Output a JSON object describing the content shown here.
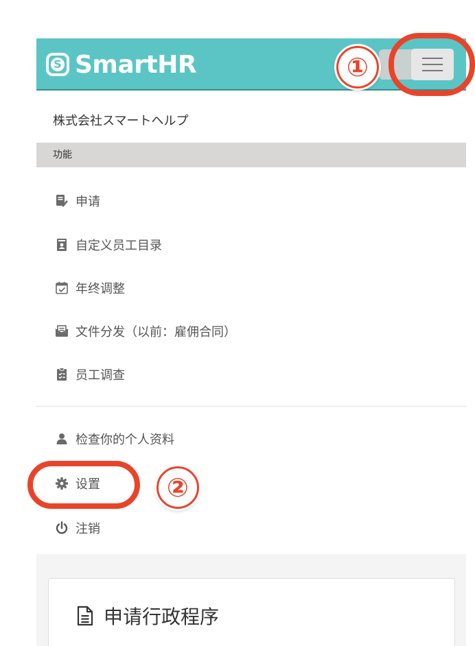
{
  "header": {
    "brand": "SmartHR",
    "brand_color": "#5bc5c6"
  },
  "annotations": {
    "badge_1": "①",
    "badge_2": "②",
    "color": "#e9442a"
  },
  "company_name": "株式会社スマートヘルプ",
  "section_label": "功能",
  "menu": {
    "features": [
      {
        "label": "申请",
        "icon": "request-check-icon"
      },
      {
        "label": "自定义员工目录",
        "icon": "address-book-icon"
      },
      {
        "label": "年终调整",
        "icon": "calendar-check-icon"
      },
      {
        "label": "文件分发（以前：雇佣合同）",
        "icon": "document-delivery-icon"
      },
      {
        "label": "员工调查",
        "icon": "clipboard-survey-icon"
      }
    ],
    "account": [
      {
        "label": "检查你的个人资料",
        "icon": "user-icon"
      },
      {
        "label": "设置",
        "icon": "gear-icon"
      },
      {
        "label": "注销",
        "icon": "power-icon"
      }
    ]
  },
  "card": {
    "title": "申请行政程序",
    "icon": "document-icon"
  }
}
